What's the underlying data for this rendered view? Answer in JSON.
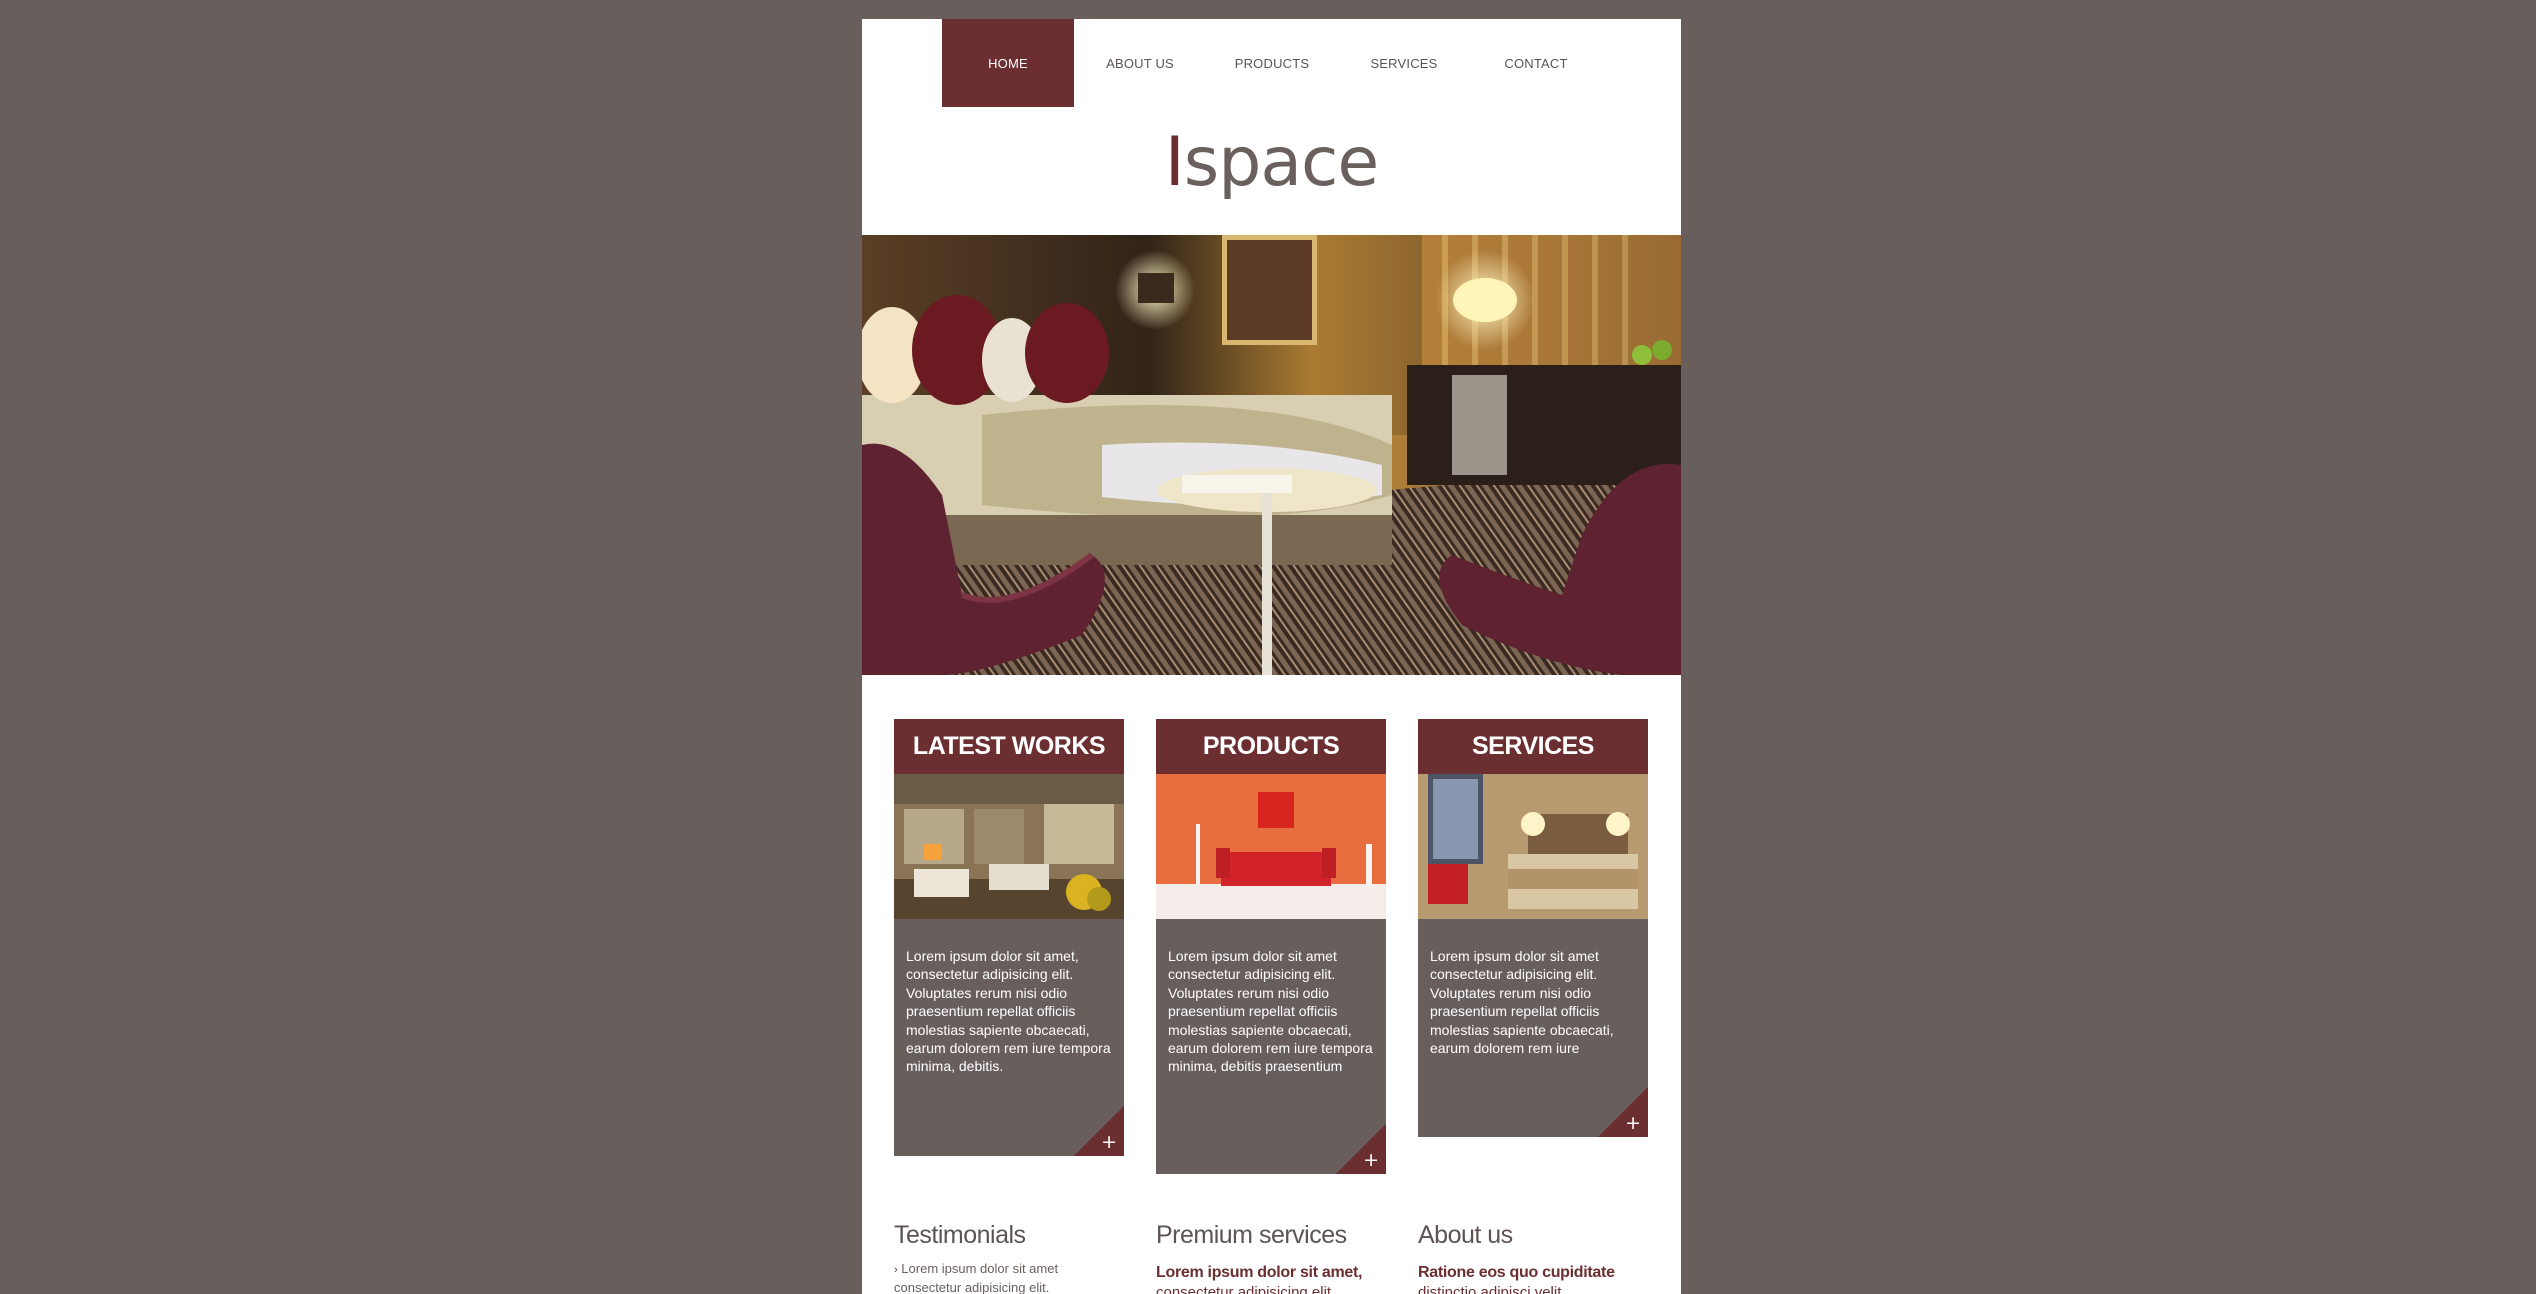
{
  "nav": {
    "items": [
      {
        "label": "HOME"
      },
      {
        "label": "ABOUT US"
      },
      {
        "label": "PRODUCTS"
      },
      {
        "label": "SERVICES"
      },
      {
        "label": "CONTACT"
      }
    ]
  },
  "logo": {
    "first_letter": "I",
    "rest": "space"
  },
  "columns": [
    {
      "title": "LATEST WORKS",
      "text": "Lorem ipsum dolor sit amet, consectetur adipisicing elit. Voluptates rerum nisi odio praesentium repellat officiis molestias sapiente obcaecati, earum dolorem rem iure tempora minima, debitis.",
      "more": "+"
    },
    {
      "title": "PRODUCTS",
      "text": "Lorem ipsum dolor sit amet consectetur adipisicing elit. Voluptates rerum nisi odio praesentium repellat officiis molestias sapiente obcaecati, earum dolorem rem iure tempora minima, debitis praesentium",
      "more": "+"
    },
    {
      "title": "SERVICES",
      "text": "Lorem ipsum dolor sit amet consectetur adipisicing elit. Voluptates rerum nisi odio praesentium repellat officiis molestias sapiente obcaecati, earum dolorem rem iure",
      "more": "+"
    }
  ],
  "bottom": {
    "testimonials": {
      "title": "Testimonials",
      "line1": "Lorem ipsum dolor sit amet",
      "line2": "consectetur adipisicing elit."
    },
    "premium": {
      "title": "Premium services",
      "sub": "Lorem ipsum dolor sit amet,",
      "sub2": "consectetur adipisicing elit."
    },
    "about": {
      "title": "About us",
      "sub": "Ratione eos quo cupiditate",
      "sub2": "distinctio adipisci velit."
    }
  },
  "colors": {
    "accent": "#6b2f31",
    "background": "#685f5d",
    "text": "#5c5452"
  }
}
